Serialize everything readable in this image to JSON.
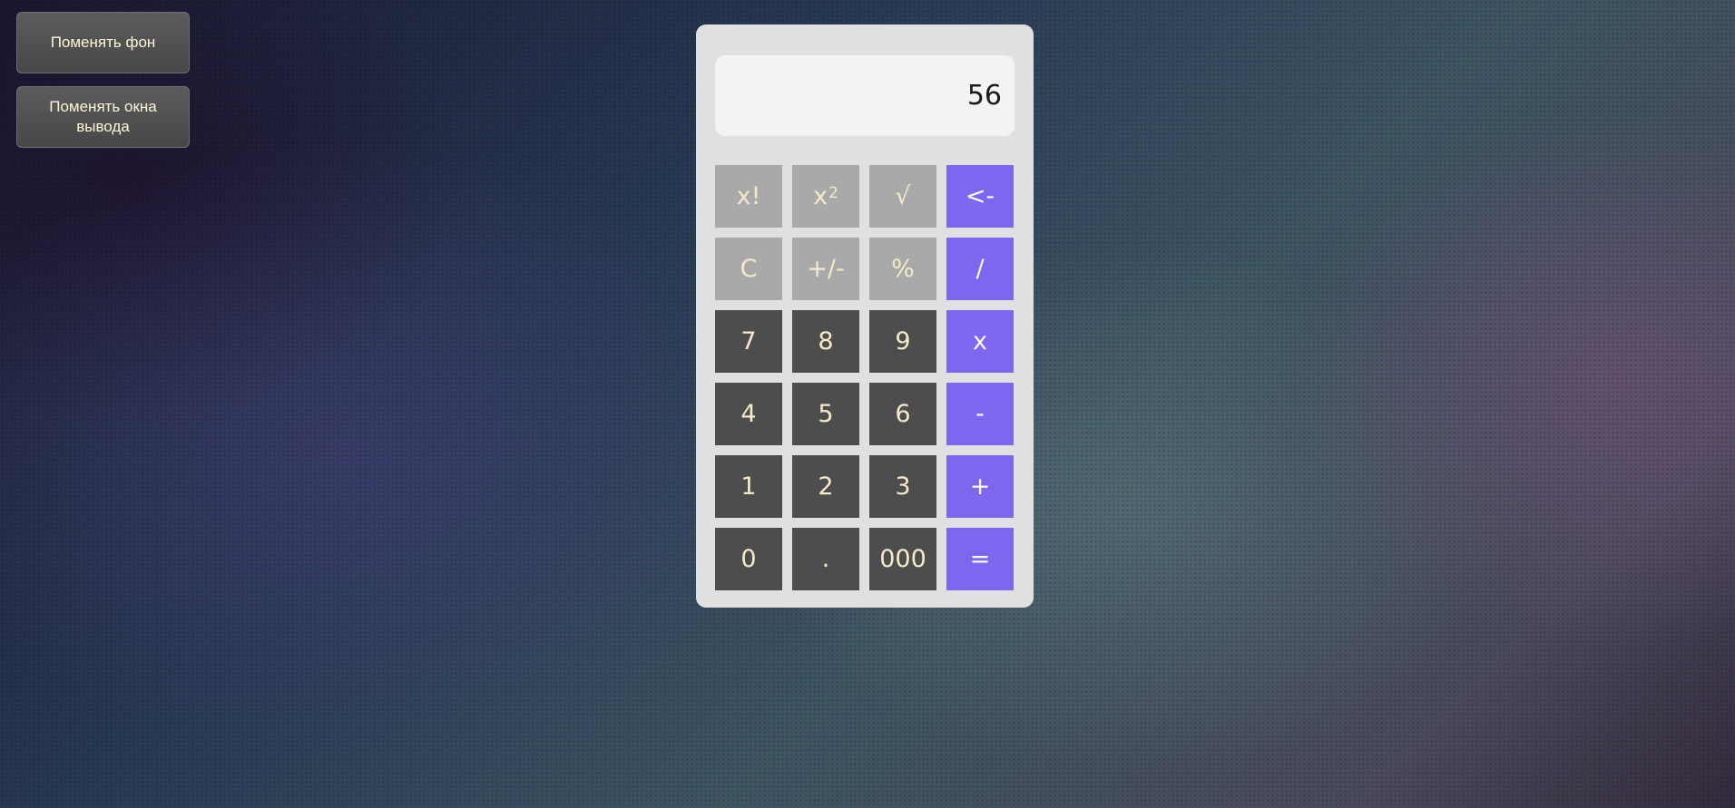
{
  "sidebar": {
    "change_background": "Поменять фон",
    "change_output": "Поменять окна вывода"
  },
  "calculator": {
    "display_value": "56",
    "keys": {
      "factorial": "x!",
      "square_base": "x",
      "square_exp": "2",
      "sqrt": "√",
      "backspace": "<-",
      "clear": "C",
      "negate": "+/-",
      "percent": "%",
      "divide": "/",
      "seven": "7",
      "eight": "8",
      "nine": "9",
      "multiply": "x",
      "four": "4",
      "five": "5",
      "six": "6",
      "minus": "-",
      "one": "1",
      "two": "2",
      "three": "3",
      "plus": "+",
      "zero": "0",
      "dot": ".",
      "triple_zero": "000",
      "equals": "="
    }
  },
  "colors": {
    "function_key": "#a9a9a9",
    "number_key": "#4d4d4d",
    "operator_key": "#7b68ee",
    "panel": "#e0e0e0",
    "display": "#f3f3f3"
  }
}
